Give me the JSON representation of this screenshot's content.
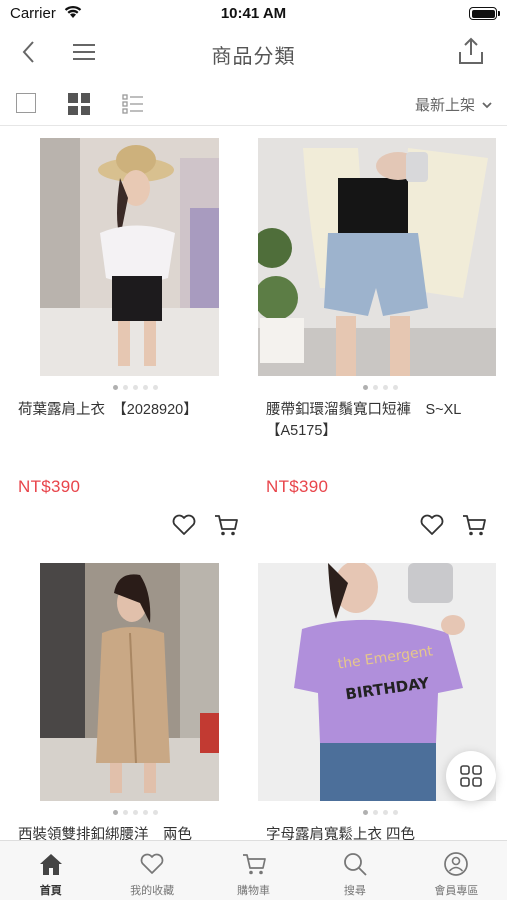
{
  "status_bar": {
    "carrier": "Carrier",
    "time": "10:41 AM",
    "battery_level": 1.0
  },
  "nav": {
    "title": "商品分類",
    "icons": [
      "back-icon",
      "menu-icon",
      "share-icon"
    ]
  },
  "filter": {
    "sort_label": "最新上架",
    "view_modes": [
      "single",
      "grid",
      "list"
    ],
    "active_view": "grid"
  },
  "products": [
    {
      "name": "荷葉露肩上衣　【2028920】",
      "price": "NT$390",
      "image_count": 5,
      "active_image": 0
    },
    {
      "name": "腰帶釦環溜鬚寬口短褲　S~XL【A5175】",
      "price": "NT$390",
      "image_count": 4,
      "active_image": 0
    },
    {
      "name": "西裝領雙排釦綁腰洋　兩色",
      "price": "",
      "image_count": 5,
      "active_image": 0
    },
    {
      "name": "字母露肩寬鬆上衣 四色",
      "price": "",
      "image_count": 4,
      "active_image": 0
    }
  ],
  "tabs": [
    {
      "label": "首頁",
      "icon": "home-icon",
      "active": true
    },
    {
      "label": "我的收藏",
      "icon": "heart-icon",
      "active": false
    },
    {
      "label": "購物車",
      "icon": "cart-icon",
      "active": false
    },
    {
      "label": "搜尋",
      "icon": "search-icon",
      "active": false
    },
    {
      "label": "會員專區",
      "icon": "user-icon",
      "active": false
    }
  ],
  "colors": {
    "price": "#e8454b",
    "text": "#333333",
    "tab_bg": "#f7f7f7"
  }
}
